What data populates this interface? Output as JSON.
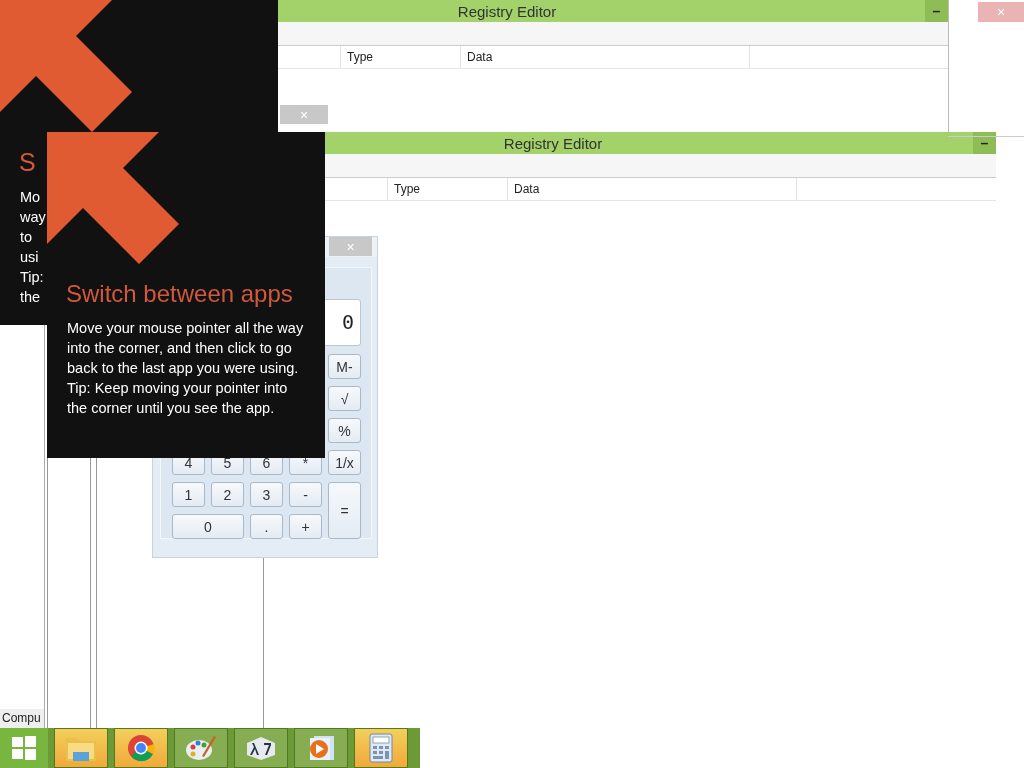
{
  "registry_windows": [
    {
      "title": "Registry Editor",
      "minimize": "–",
      "columns": [
        "Type",
        "Data"
      ]
    },
    {
      "title": "Registry Editor",
      "minimize": "–",
      "columns": [
        "Type",
        "Data"
      ]
    }
  ],
  "stray_close_buttons": [
    {
      "label": "×"
    },
    {
      "label": "×"
    }
  ],
  "calculator": {
    "close": "×",
    "display": "0",
    "keys": [
      "M-",
      "√",
      "%",
      "4",
      "5",
      "6",
      "*",
      "1/x",
      "1",
      "2",
      "3",
      "-",
      "=",
      "0",
      ".",
      "+"
    ]
  },
  "tips": [
    {
      "title": "S",
      "lines": [
        "Mo",
        "way",
        "to",
        "usi",
        "Tip:",
        "the"
      ]
    },
    {
      "title": "Switch between apps",
      "lines": [
        "Move your mouse pointer all the way into the corner, and then click to go back to the last app you were using.",
        "Tip: Keep moving your pointer into the corner until you see the app."
      ]
    }
  ],
  "side_window": {
    "label": "Compu"
  },
  "taskbar": {
    "items": [
      {
        "kind": "folder",
        "highlighted": true
      },
      {
        "kind": "browser",
        "highlighted": true
      },
      {
        "kind": "palette",
        "highlighted": false
      },
      {
        "kind": "lambda",
        "highlighted": false
      },
      {
        "kind": "player",
        "highlighted": false
      },
      {
        "kind": "calculator",
        "highlighted": true
      }
    ]
  }
}
